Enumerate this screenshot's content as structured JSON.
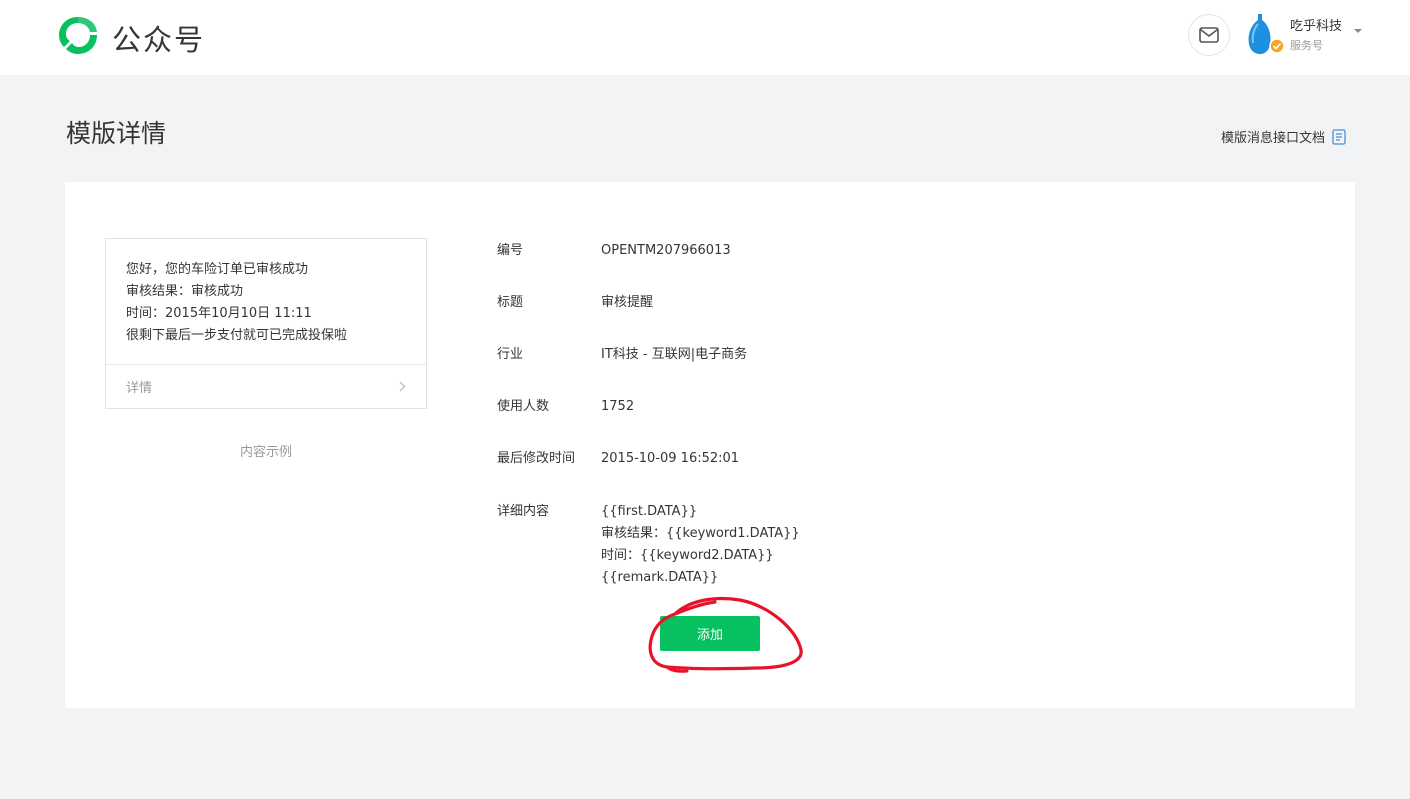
{
  "header": {
    "app_name": "公众号",
    "brand_color": "#07c160",
    "account_name": "吃乎科技",
    "account_type": "服务号"
  },
  "page": {
    "title": "模版详情",
    "doc_link": "模版消息接口文档"
  },
  "preview": {
    "lines": [
      "您好，您的车险订单已审核成功",
      "审核结果：审核成功",
      "时间：2015年10月10日 11:11",
      "很剩下最后一步支付就可已完成投保啦"
    ],
    "details_link": "详情",
    "caption": "内容示例"
  },
  "info": {
    "id_label": "编号",
    "id_value": "OPENTM207966013",
    "title_label": "标题",
    "title_value": "审核提醒",
    "industry_label": "行业",
    "industry_value": "IT科技 - 互联网|电子商务",
    "users_label": "使用人数",
    "users_value": "1752",
    "modified_label": "最后修改时间",
    "modified_value": "2015-10-09 16:52:01",
    "content_label": "详细内容",
    "content_lines": [
      "{{first.DATA}}",
      "审核结果：{{keyword1.DATA}}",
      "时间：{{keyword2.DATA}}",
      "{{remark.DATA}}"
    ]
  },
  "actions": {
    "add_label": "添加",
    "add_color": "#07c160"
  },
  "annotation_color": "#e8132b",
  "icons": [
    "wechat-logo-icon",
    "mail-icon",
    "avatar-icon",
    "verified-badge-icon",
    "chevron-down-icon",
    "document-icon",
    "chevron-right-icon"
  ]
}
